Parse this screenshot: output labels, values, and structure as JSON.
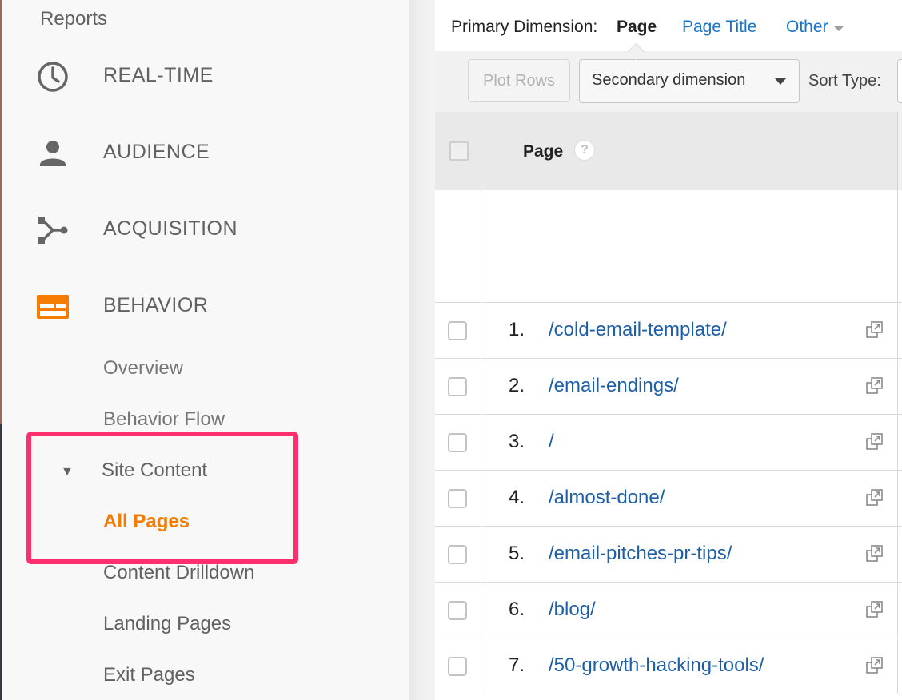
{
  "sidebar": {
    "title": "Reports",
    "nav": [
      {
        "label": "REAL-TIME",
        "icon": "clock-icon"
      },
      {
        "label": "AUDIENCE",
        "icon": "person-icon"
      },
      {
        "label": "ACQUISITION",
        "icon": "acquisition-icon"
      },
      {
        "label": "BEHAVIOR",
        "icon": "behavior-icon"
      }
    ],
    "behavior_sub": {
      "overview": "Overview",
      "behavior_flow": "Behavior Flow",
      "site_content": "Site Content",
      "all_pages": "All Pages",
      "content_drilldown": "Content Drilldown",
      "landing_pages": "Landing Pages",
      "exit_pages": "Exit Pages"
    },
    "colors": {
      "active": "#f57c00",
      "highlight": "#ff2f6e"
    }
  },
  "primary_dimension": {
    "label": "Primary Dimension:",
    "current": "Page",
    "links": [
      "Page Title",
      "Other"
    ]
  },
  "toolbar": {
    "plot_rows": "Plot Rows",
    "secondary_dimension": "Secondary dimension",
    "sort_type": "Sort Type:"
  },
  "table": {
    "column": "Page",
    "help": "?",
    "rows": [
      {
        "num": "1.",
        "page": "/cold-email-template/"
      },
      {
        "num": "2.",
        "page": "/email-endings/"
      },
      {
        "num": "3.",
        "page": "/"
      },
      {
        "num": "4.",
        "page": "/almost-done/"
      },
      {
        "num": "5.",
        "page": "/email-pitches-pr-tips/"
      },
      {
        "num": "6.",
        "page": "/blog/"
      },
      {
        "num": "7.",
        "page": "/50-growth-hacking-tools/"
      }
    ]
  }
}
